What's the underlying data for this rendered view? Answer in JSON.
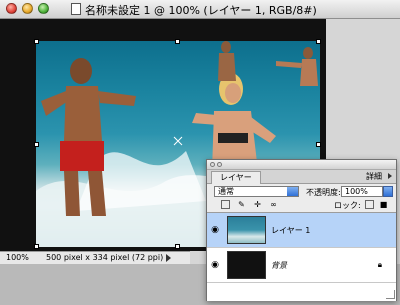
{
  "window": {
    "title": "名称未設定 1 @ 100% (レイヤー 1, RGB/8#)"
  },
  "status": {
    "zoom": "100%",
    "document_info": "500 pixel x 334 pixel (72 ppi)"
  },
  "layers_palette": {
    "tab_label": "レイヤー",
    "menu_label": "詳細",
    "blend_mode": "通常",
    "opacity_label": "不透明度:",
    "opacity_value": "100%",
    "lock_label": "ロック:",
    "layers": [
      {
        "name": "レイヤー 1",
        "selected": true,
        "visible": true
      },
      {
        "name": "背景",
        "selected": false,
        "visible": true,
        "locked": true
      }
    ]
  },
  "icons": [
    "close-icon",
    "minimize-icon",
    "zoom-icon",
    "document-icon",
    "eye-icon",
    "lock-icon",
    "chevron-right-icon",
    "stepper-icon"
  ],
  "colors": {
    "selection": "#b6d3f8",
    "accent": "#2f6fd6",
    "canvas_bg": "#111111"
  }
}
